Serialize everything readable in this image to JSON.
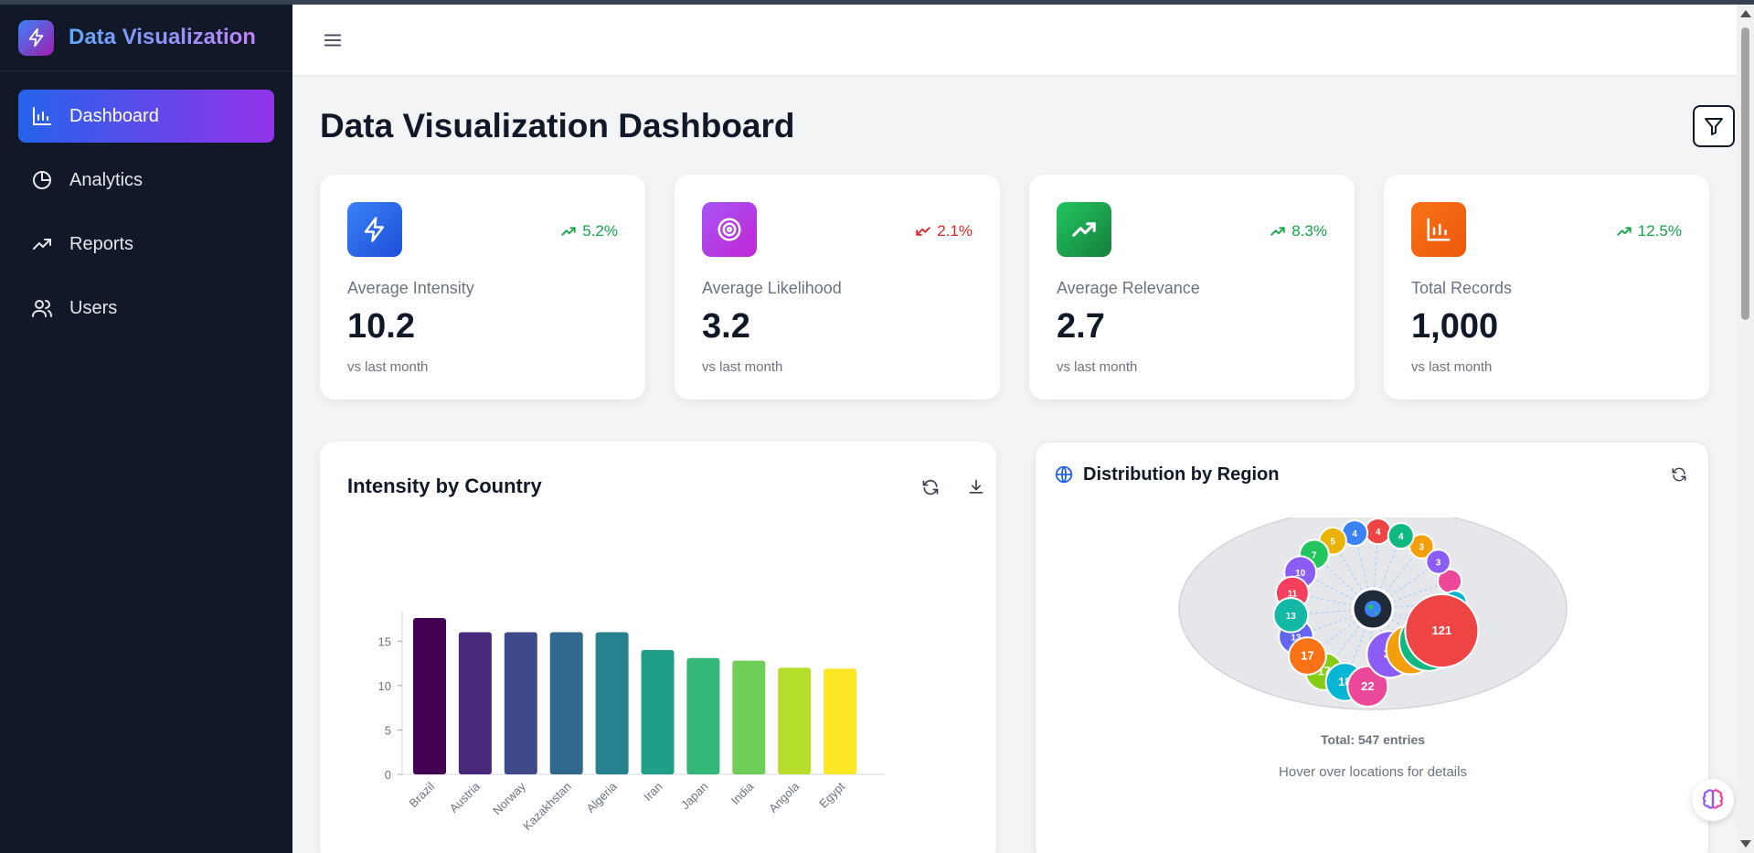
{
  "app": {
    "title": "Data Visualization",
    "logo_icon": "lightning-icon",
    "brand_gradient": [
      "#60a5fa",
      "#c084fc"
    ]
  },
  "sidebar": {
    "items": [
      {
        "label": "Dashboard",
        "icon": "bar-chart-icon",
        "active": true
      },
      {
        "label": "Analytics",
        "icon": "pie-chart-icon",
        "active": false
      },
      {
        "label": "Reports",
        "icon": "trending-up-icon",
        "active": false
      },
      {
        "label": "Users",
        "icon": "users-icon",
        "active": false
      }
    ]
  },
  "header": {
    "title": "Data Visualization Dashboard"
  },
  "stats": [
    {
      "label": "Average Intensity",
      "value": "10.2",
      "trend": "5.2%",
      "trend_dir": "up",
      "sub": "vs last month",
      "icon": "lightning-icon",
      "color": "#2563eb"
    },
    {
      "label": "Average Likelihood",
      "value": "3.2",
      "trend": "2.1%",
      "trend_dir": "down",
      "sub": "vs last month",
      "icon": "target-icon",
      "color": "#a21caf"
    },
    {
      "label": "Average Relevance",
      "value": "2.7",
      "trend": "8.3%",
      "trend_dir": "up",
      "sub": "vs last month",
      "icon": "trending-up-icon",
      "color": "#16a34a"
    },
    {
      "label": "Total Records",
      "value": "1,000",
      "trend": "12.5%",
      "trend_dir": "up",
      "sub": "vs last month",
      "icon": "bar-chart-icon",
      "color": "#ea580c"
    }
  ],
  "intensity_panel": {
    "title": "Intensity by Country"
  },
  "region_panel": {
    "title": "Distribution by Region",
    "total": "Total: 547 entries",
    "hint": "Hover over locations for details"
  },
  "chart_data": [
    {
      "type": "bar",
      "title": "Intensity by Country",
      "categories": [
        "Brazil",
        "Austria",
        "Norway",
        "Kazakhstan",
        "Algeria",
        "Iran",
        "Japan",
        "India",
        "Angola",
        "Egypt"
      ],
      "values": [
        17.6,
        16,
        16,
        16,
        16,
        14,
        13.1,
        12.8,
        12,
        11.9
      ],
      "colors": [
        "#440154",
        "#482878",
        "#3e4989",
        "#31688e",
        "#26828e",
        "#1f9e89",
        "#35b779",
        "#6ece58",
        "#b5de2b",
        "#fde725"
      ],
      "yticks": [
        "0",
        "5",
        "10",
        "15"
      ],
      "ylim": [
        0,
        17.6
      ],
      "grid": false
    },
    {
      "type": "bubble",
      "title": "Distribution by Region",
      "labels": [
        "4",
        "4",
        "3",
        "3",
        "",
        "",
        "",
        "121",
        "64",
        "40",
        "34",
        "22",
        "18",
        "17",
        "17",
        "13",
        "13",
        "11",
        "10",
        "7",
        "5",
        "4"
      ],
      "values": [
        4,
        4,
        3,
        3,
        2,
        2,
        2,
        121,
        64,
        40,
        34,
        22,
        18,
        17,
        17,
        13,
        13,
        11,
        10,
        7,
        5,
        4
      ],
      "colors": [
        "#ef4444",
        "#10b981",
        "#f59e0b",
        "#8b5cf6",
        "#ec4899",
        "#06b6d4",
        "#84cc16",
        "#ef4444",
        "#10b981",
        "#f59e0b",
        "#8b5cf6",
        "#ec4899",
        "#06b6d4",
        "#84cc16",
        "#f97316",
        "#6366f1",
        "#14b8a6",
        "#f43f5e",
        "#8b5cf6",
        "#22c55e",
        "#eab308",
        "#3b82f6"
      ],
      "center_icon": "globe-emoji"
    }
  ]
}
